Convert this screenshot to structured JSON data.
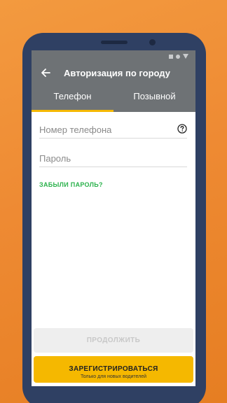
{
  "appbar": {
    "title": "Авторизация по городу",
    "back_icon": "arrow-left-icon",
    "status_icons": [
      "square-icon",
      "circle-icon",
      "triangle-icon"
    ]
  },
  "tabs": [
    {
      "label": "Телефон",
      "selected": true
    },
    {
      "label": "Позывной",
      "selected": false
    }
  ],
  "form": {
    "phone_placeholder": "Номер телефона",
    "phone_value": "",
    "password_placeholder": "Пароль",
    "password_value": "",
    "help_icon": "question-circle-icon",
    "forgot_label": "ЗАБЫЛИ ПАРОЛЬ?"
  },
  "buttons": {
    "continue_label": "ПРОДОЛЖИТЬ",
    "register_label": "ЗАРЕГИСТРИРОВАТЬСЯ",
    "register_sublabel": "Только для новых водителей"
  },
  "colors": {
    "background": "#ee8a33",
    "phone_frame": "#2f4063",
    "appbar": "#6e7275",
    "accent": "#f5b800",
    "link": "#2bb24c"
  }
}
